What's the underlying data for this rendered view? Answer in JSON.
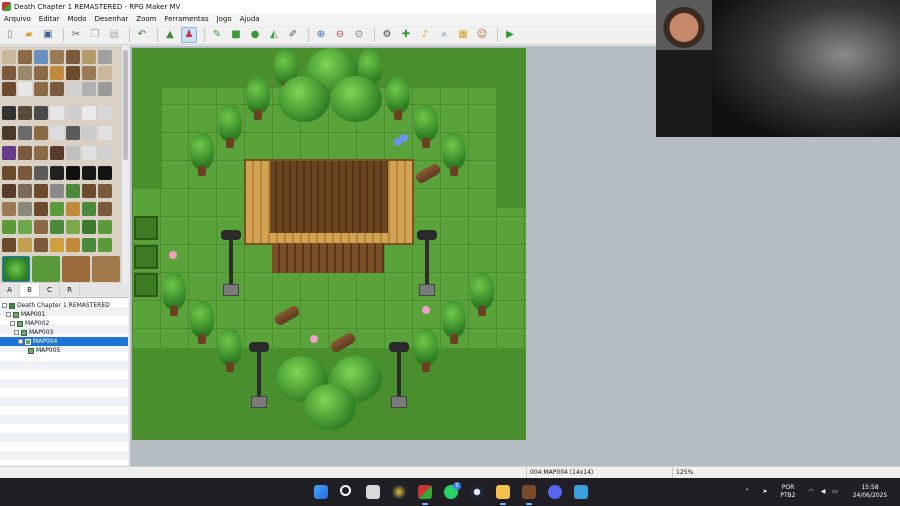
{
  "window": {
    "title": "Death Chapter 1 REMASTERED - RPG Maker MV"
  },
  "menu": {
    "items": [
      "Arquivo",
      "Editar",
      "Modo",
      "Desenhar",
      "Zoom",
      "Ferramentas",
      "Jogo",
      "Ajuda"
    ]
  },
  "toolbar": {
    "buttons": [
      {
        "icon": "new-project-icon"
      },
      {
        "icon": "open-project-icon"
      },
      {
        "icon": "save-icon"
      },
      {
        "icon": "cut-icon"
      },
      {
        "icon": "copy-icon"
      },
      {
        "icon": "paste-icon"
      },
      {
        "icon": "undo-icon"
      },
      {
        "icon": "map-mode-icon"
      },
      {
        "icon": "event-mode-icon"
      },
      {
        "icon": "pencil-icon"
      },
      {
        "icon": "rectangle-icon"
      },
      {
        "icon": "ellipse-icon"
      },
      {
        "icon": "fill-icon"
      },
      {
        "icon": "shadow-pen-icon"
      },
      {
        "icon": "zoom-in-icon"
      },
      {
        "icon": "zoom-out-icon"
      },
      {
        "icon": "actual-size-icon"
      },
      {
        "icon": "database-icon"
      },
      {
        "icon": "plugin-manager-icon"
      },
      {
        "icon": "sound-test-icon"
      },
      {
        "icon": "event-searcher-icon"
      },
      {
        "icon": "resource-manager-icon"
      },
      {
        "icon": "character-generator-icon"
      },
      {
        "icon": "playtest-icon"
      }
    ]
  },
  "tileset_tabs": [
    "A",
    "B",
    "C",
    "R"
  ],
  "tileset_selected_tab": "B",
  "map_tree": {
    "project": "Death Chapter 1 REMASTERED",
    "maps": [
      {
        "name": "MAP001",
        "indent": 1,
        "selected": false
      },
      {
        "name": "MAP002",
        "indent": 2,
        "selected": false
      },
      {
        "name": "MAP003",
        "indent": 3,
        "selected": false
      },
      {
        "name": "MAP004",
        "indent": 4,
        "selected": true
      },
      {
        "name": "MAP005",
        "indent": 5,
        "selected": false
      }
    ]
  },
  "statusbar": {
    "map_info": "004:MAP004 (14x14)",
    "zoom": "125%"
  },
  "taskbar": {
    "whatsapp_badge": "5",
    "lang_top": "POR",
    "lang_bottom": "PTB2",
    "time": "15:58",
    "date": "24/06/2025"
  }
}
